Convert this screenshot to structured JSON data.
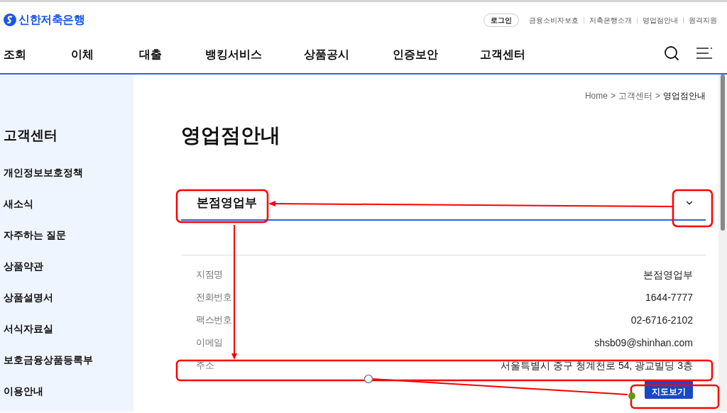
{
  "header": {
    "logo": "신한저축은행",
    "login": "로그인",
    "util_links": [
      "금융소비자보호",
      "저축은행소개",
      "영업점안내",
      "원격지원"
    ]
  },
  "nav": [
    "조회",
    "이체",
    "대출",
    "뱅킹서비스",
    "상품공시",
    "인증보안",
    "고객센터"
  ],
  "sidebar": {
    "title": "고객센터",
    "items": [
      "개인정보보호정책",
      "새소식",
      "자주하는 질문",
      "상품약관",
      "상품설명서",
      "서식자료실",
      "보호금융상품등록부",
      "이용안내"
    ]
  },
  "breadcrumb": {
    "items": [
      "Home",
      "고객센터",
      "영업점안내"
    ],
    "separator": ">"
  },
  "page_title": "영업점안내",
  "branch_select": {
    "value": "본점영업부"
  },
  "details": [
    {
      "label": "지점명",
      "value": "본점영업부"
    },
    {
      "label": "전화번호",
      "value": "1644-7777"
    },
    {
      "label": "팩스번호",
      "value": "02-6716-2102"
    },
    {
      "label": "이메일",
      "value": "shsb09@shinhan.com"
    },
    {
      "label": "주소",
      "value": "서울특별시 중구 청계천로 54, 광교빌딩 3층"
    }
  ],
  "map_button": "지도보기"
}
